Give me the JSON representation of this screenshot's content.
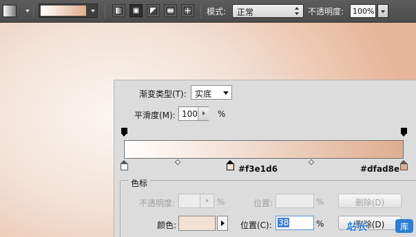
{
  "toolbar": {
    "mode_label": "模式:",
    "mode_value": "正常",
    "opacity_label": "不透明度:",
    "opacity_value": "100%",
    "gradient_types": [
      "linear",
      "radial",
      "angle",
      "reflected",
      "diamond"
    ],
    "selected_gradient_type": "radial",
    "gradient_preview_colors": [
      "#ffffff",
      "#dfad8e"
    ]
  },
  "editor": {
    "gradient_type_label": "渐变类型(T):",
    "gradient_type_value": "实底",
    "smoothness_label": "平滑度(M):",
    "smoothness_value": "100",
    "smoothness_unit": "%",
    "bar_colors": [
      "#ffffff",
      "#f3e1d6",
      "#dfad8e"
    ],
    "stop_mid_hex": "#f3e1d6",
    "stop_right_hex": "#dfad8e",
    "stops_group": {
      "title": "色标",
      "opacity_label": "不透明度:",
      "opacity_unit": "%",
      "location_label": "位置:",
      "location_unit": "%",
      "delete_label": "删除(D)",
      "color_label": "颜色:",
      "color_value": "#f3e1d6",
      "location2_label": "位置(C):",
      "location2_value": "38",
      "location2_unit": "%",
      "delete2_label": "删除(D)"
    }
  },
  "watermark": {
    "text": "站长",
    "badge": "库"
  }
}
